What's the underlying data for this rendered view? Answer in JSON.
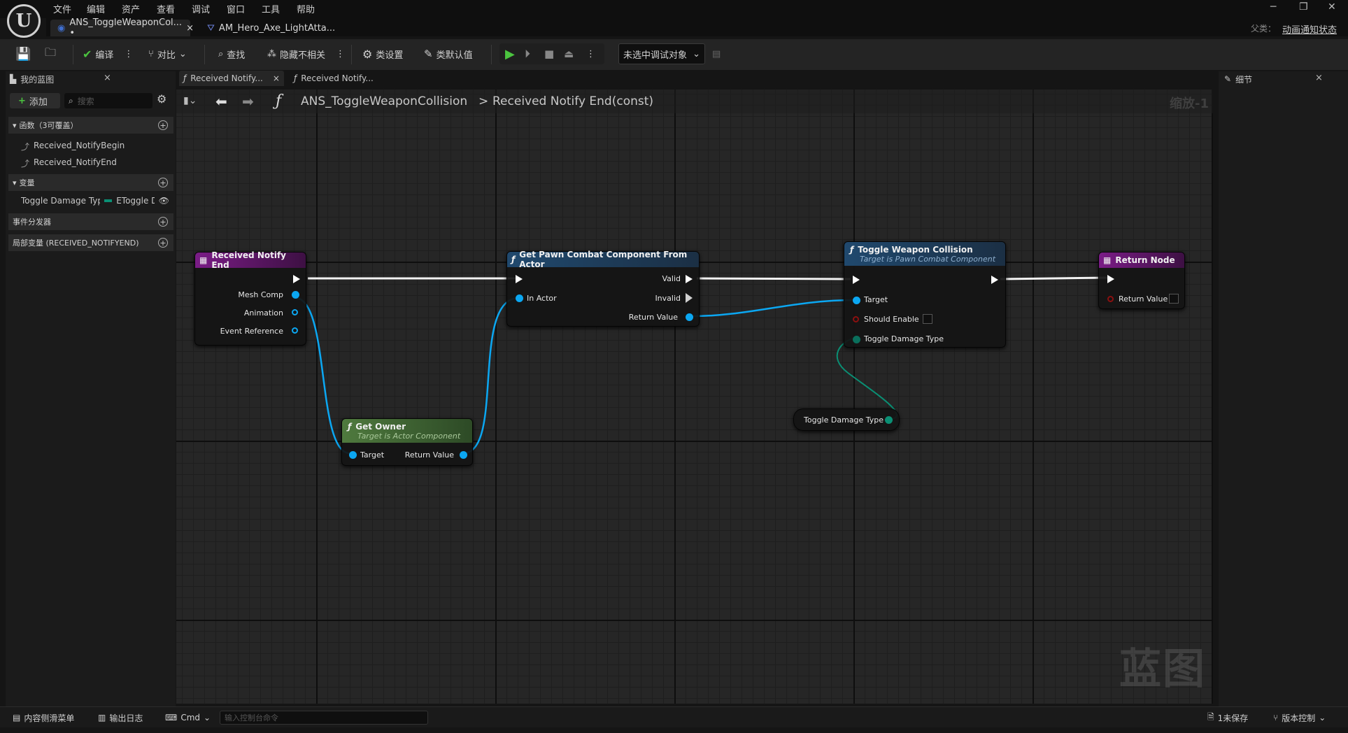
{
  "app": {
    "menus": [
      "文件",
      "编辑",
      "资产",
      "查看",
      "调试",
      "窗口",
      "工具",
      "帮助"
    ],
    "parent_label": "父类：",
    "parent_value": "动画通知状态",
    "logo_glyph": "U"
  },
  "doc_tabs": [
    {
      "label": "ANS_ToggleWeaponCol... •",
      "close": "×"
    },
    {
      "label": "AM_Hero_Axe_LightAtta..."
    }
  ],
  "toolbar": {
    "compile": "编译",
    "diff": "对比",
    "find": "查找",
    "hide_unrelated": "隐藏不相关",
    "class_settings": "类设置",
    "class_defaults": "类默认值",
    "debug_object": "未选中调试对象"
  },
  "my_blueprint": {
    "title": "我的蓝图",
    "add": "添加",
    "search_placeholder": "搜索",
    "functions_header": "函数（3可覆盖）",
    "functions": [
      "Received_NotifyBegin",
      "Received_NotifyEnd"
    ],
    "variables_header": "变量",
    "variable": {
      "name": "Toggle Damage Typ",
      "type": "EToggle D"
    },
    "dispatchers_header": "事件分发器",
    "locals_header": "局部变量 (RECEIVED_NOTIFYEND)"
  },
  "graph_tabs": [
    "Received Notify...",
    "Received Notify..."
  ],
  "graph": {
    "breadcrumb_root": "ANS_ToggleWeaponCollision",
    "breadcrumb_sep": ">",
    "breadcrumb_leaf": "Received Notify End(const)",
    "zoom": "缩放-1",
    "watermark": "蓝图",
    "nodes": {
      "received_notify_end": {
        "title": "Received Notify End",
        "pins": [
          "Mesh Comp",
          "Animation",
          "Event Reference"
        ]
      },
      "get_pawn_combat": {
        "title": "Get Pawn Combat Component From Actor",
        "in_actor": "In Actor",
        "valid": "Valid",
        "invalid": "Invalid",
        "return_value": "Return Value"
      },
      "toggle_weapon_collision": {
        "title": "Toggle Weapon Collision",
        "subtitle": "Target is Pawn Combat Component",
        "target": "Target",
        "should_enable": "Should Enable",
        "toggle_damage_type": "Toggle Damage Type"
      },
      "return_node": {
        "title": "Return Node",
        "return_value": "Return Value"
      },
      "get_owner": {
        "title": "Get Owner",
        "subtitle": "Target is Actor Component",
        "target": "Target",
        "return_value": "Return Value"
      },
      "var_get": {
        "label": "Toggle Damage Type"
      }
    }
  },
  "details": {
    "title": "细节"
  },
  "bottom": {
    "content_drawer": "内容侧滑菜单",
    "output_log": "输出日志",
    "cmd": "Cmd",
    "console_placeholder": "输入控制台命令",
    "unsaved": "1未保存",
    "source_control": "版本控制"
  },
  "colors": {
    "event_header": "#7a1c86",
    "func_header": "#20496e",
    "pure_header": "#4f7a3e",
    "object_pin": "#0ba7f2",
    "enum_pin": "#0a6f5c",
    "bool_pin": "#8c1010",
    "compile_green": "#4bc43f"
  }
}
